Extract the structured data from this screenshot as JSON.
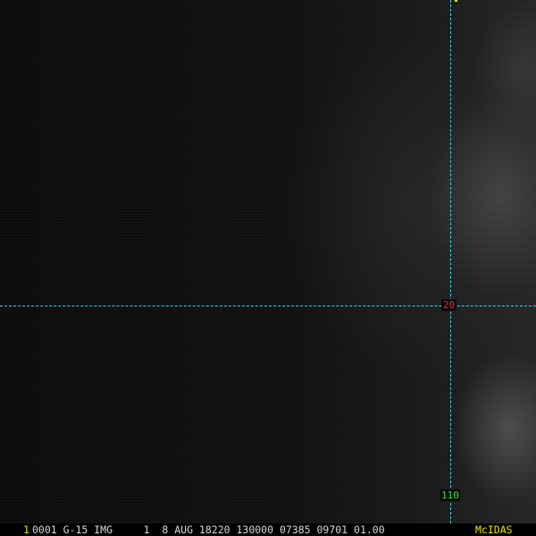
{
  "status_bar": {
    "frame_number": "1",
    "header_text": "0001 G-15 IMG     1  8 AUG 18220 130000 07385 09701 01.00",
    "brand": "McIDAS"
  },
  "grid": {
    "latitude_label": "20",
    "longitude_label": "110",
    "line_color": "#38d6d6",
    "latitude_color": "#e03030",
    "longitude_color": "#40e040"
  },
  "colors": {
    "frame_number": "#e6e600",
    "brand": "#e6e600",
    "header_text": "#d8d8d8",
    "background": "#0a0a0a"
  }
}
